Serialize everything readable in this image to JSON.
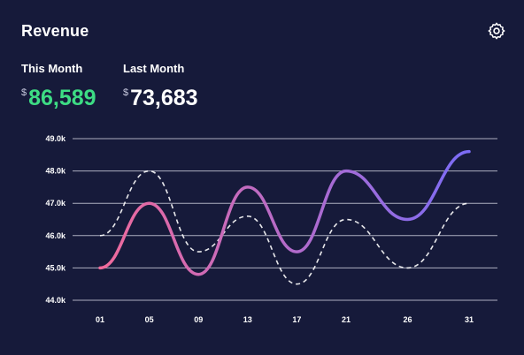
{
  "card": {
    "title": "Revenue"
  },
  "icons": {
    "settings": "gear-icon"
  },
  "stats": {
    "this_month": {
      "label": "This Month",
      "currency": "$",
      "value": "86,589",
      "color": "#3ddc84"
    },
    "last_month": {
      "label": "Last Month",
      "currency": "$",
      "value": "73,683",
      "color": "#ffffff"
    }
  },
  "chart_data": {
    "type": "line",
    "categories": [
      "01",
      "05",
      "09",
      "13",
      "17",
      "21",
      "26",
      "31"
    ],
    "ylim": [
      44.0,
      49.0
    ],
    "yticks": [
      "44.0k",
      "45.0k",
      "46.0k",
      "47.0k",
      "48.0k",
      "49.0k"
    ],
    "grid": true,
    "series": [
      {
        "style": "solid-gradient",
        "colors": [
          "#f06a9b",
          "#7b6cf6"
        ],
        "x": [
          1,
          5,
          9,
          13,
          17,
          21,
          26,
          31
        ],
        "values": [
          45.0,
          47.0,
          44.8,
          47.5,
          45.5,
          48.0,
          46.5,
          48.6
        ]
      },
      {
        "style": "dashed",
        "color": "#ffffff",
        "x": [
          1,
          5,
          9,
          13,
          17,
          21,
          26,
          31
        ],
        "values": [
          46.0,
          48.0,
          45.5,
          46.6,
          44.5,
          46.5,
          45.0,
          47.0
        ]
      }
    ]
  }
}
